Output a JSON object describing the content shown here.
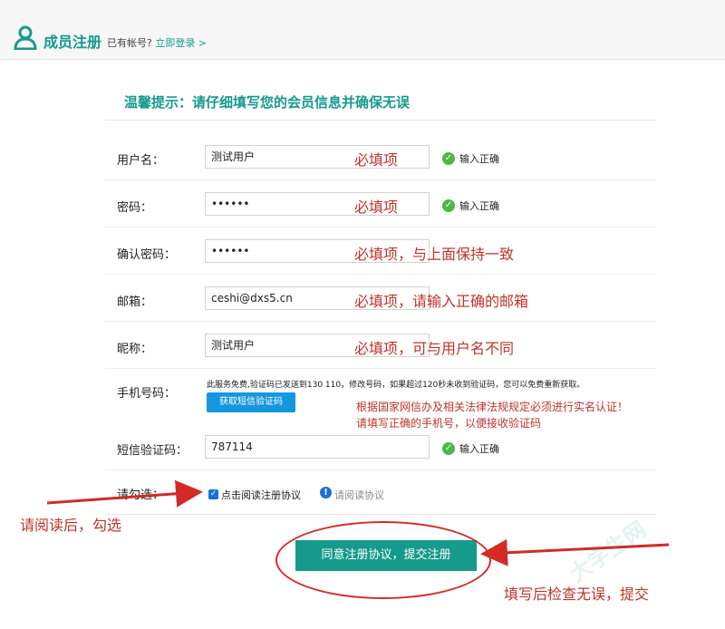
{
  "header": {
    "title": "成员注册",
    "sub_text": "已有帐号?",
    "login_link": "立即登录 >"
  },
  "tip": "温馨提示：请仔细填写您的会员信息并确保无误",
  "form": {
    "username": {
      "label": "用户名：",
      "value": "测试用户",
      "note": "必填项",
      "status": "输入正确"
    },
    "password": {
      "label": "密码：",
      "value": "••••••",
      "note": "必填项",
      "status": "输入正确"
    },
    "confirm_password": {
      "label": "确认密码：",
      "value": "••••••",
      "note": "必填项，与上面保持一致"
    },
    "email": {
      "label": "邮箱：",
      "value": "ceshi@dxs5.cn",
      "note": "必填项，请输入正确的邮箱"
    },
    "nickname": {
      "label": "昵称：",
      "value": "测试用户",
      "note": "必填项，可与用户名不同"
    },
    "phone": {
      "label": "手机号码：",
      "info": "此服务免费,验证码已发送到130        110，修改号码，如果超过120秒未收到验证码，您可以免费重新获取。",
      "sms_button": "获取短信验证码",
      "legal_line1": "根据国家网信办及相关法律法规规定必须进行实名认证！",
      "legal_line2": "请填写正确的手机号，以便接收验证码"
    },
    "sms_code": {
      "label": "短信验证码：",
      "value": "787114",
      "status": "输入正确"
    },
    "agreement": {
      "label": "请勾选：",
      "checkbox_label": "点击阅读注册协议",
      "read_link": "请阅读协议",
      "checked": true
    }
  },
  "submit_label": "同意注册协议，提交注册",
  "annotations": {
    "left": "请阅读后，勾选",
    "right": "填写后检查无误，提交"
  },
  "watermark": "大学生网",
  "colors": {
    "brand": "#169a8c",
    "annotation_red": "#c0332a",
    "ok_green": "#4cb847",
    "sms_blue": "#1597e0"
  }
}
